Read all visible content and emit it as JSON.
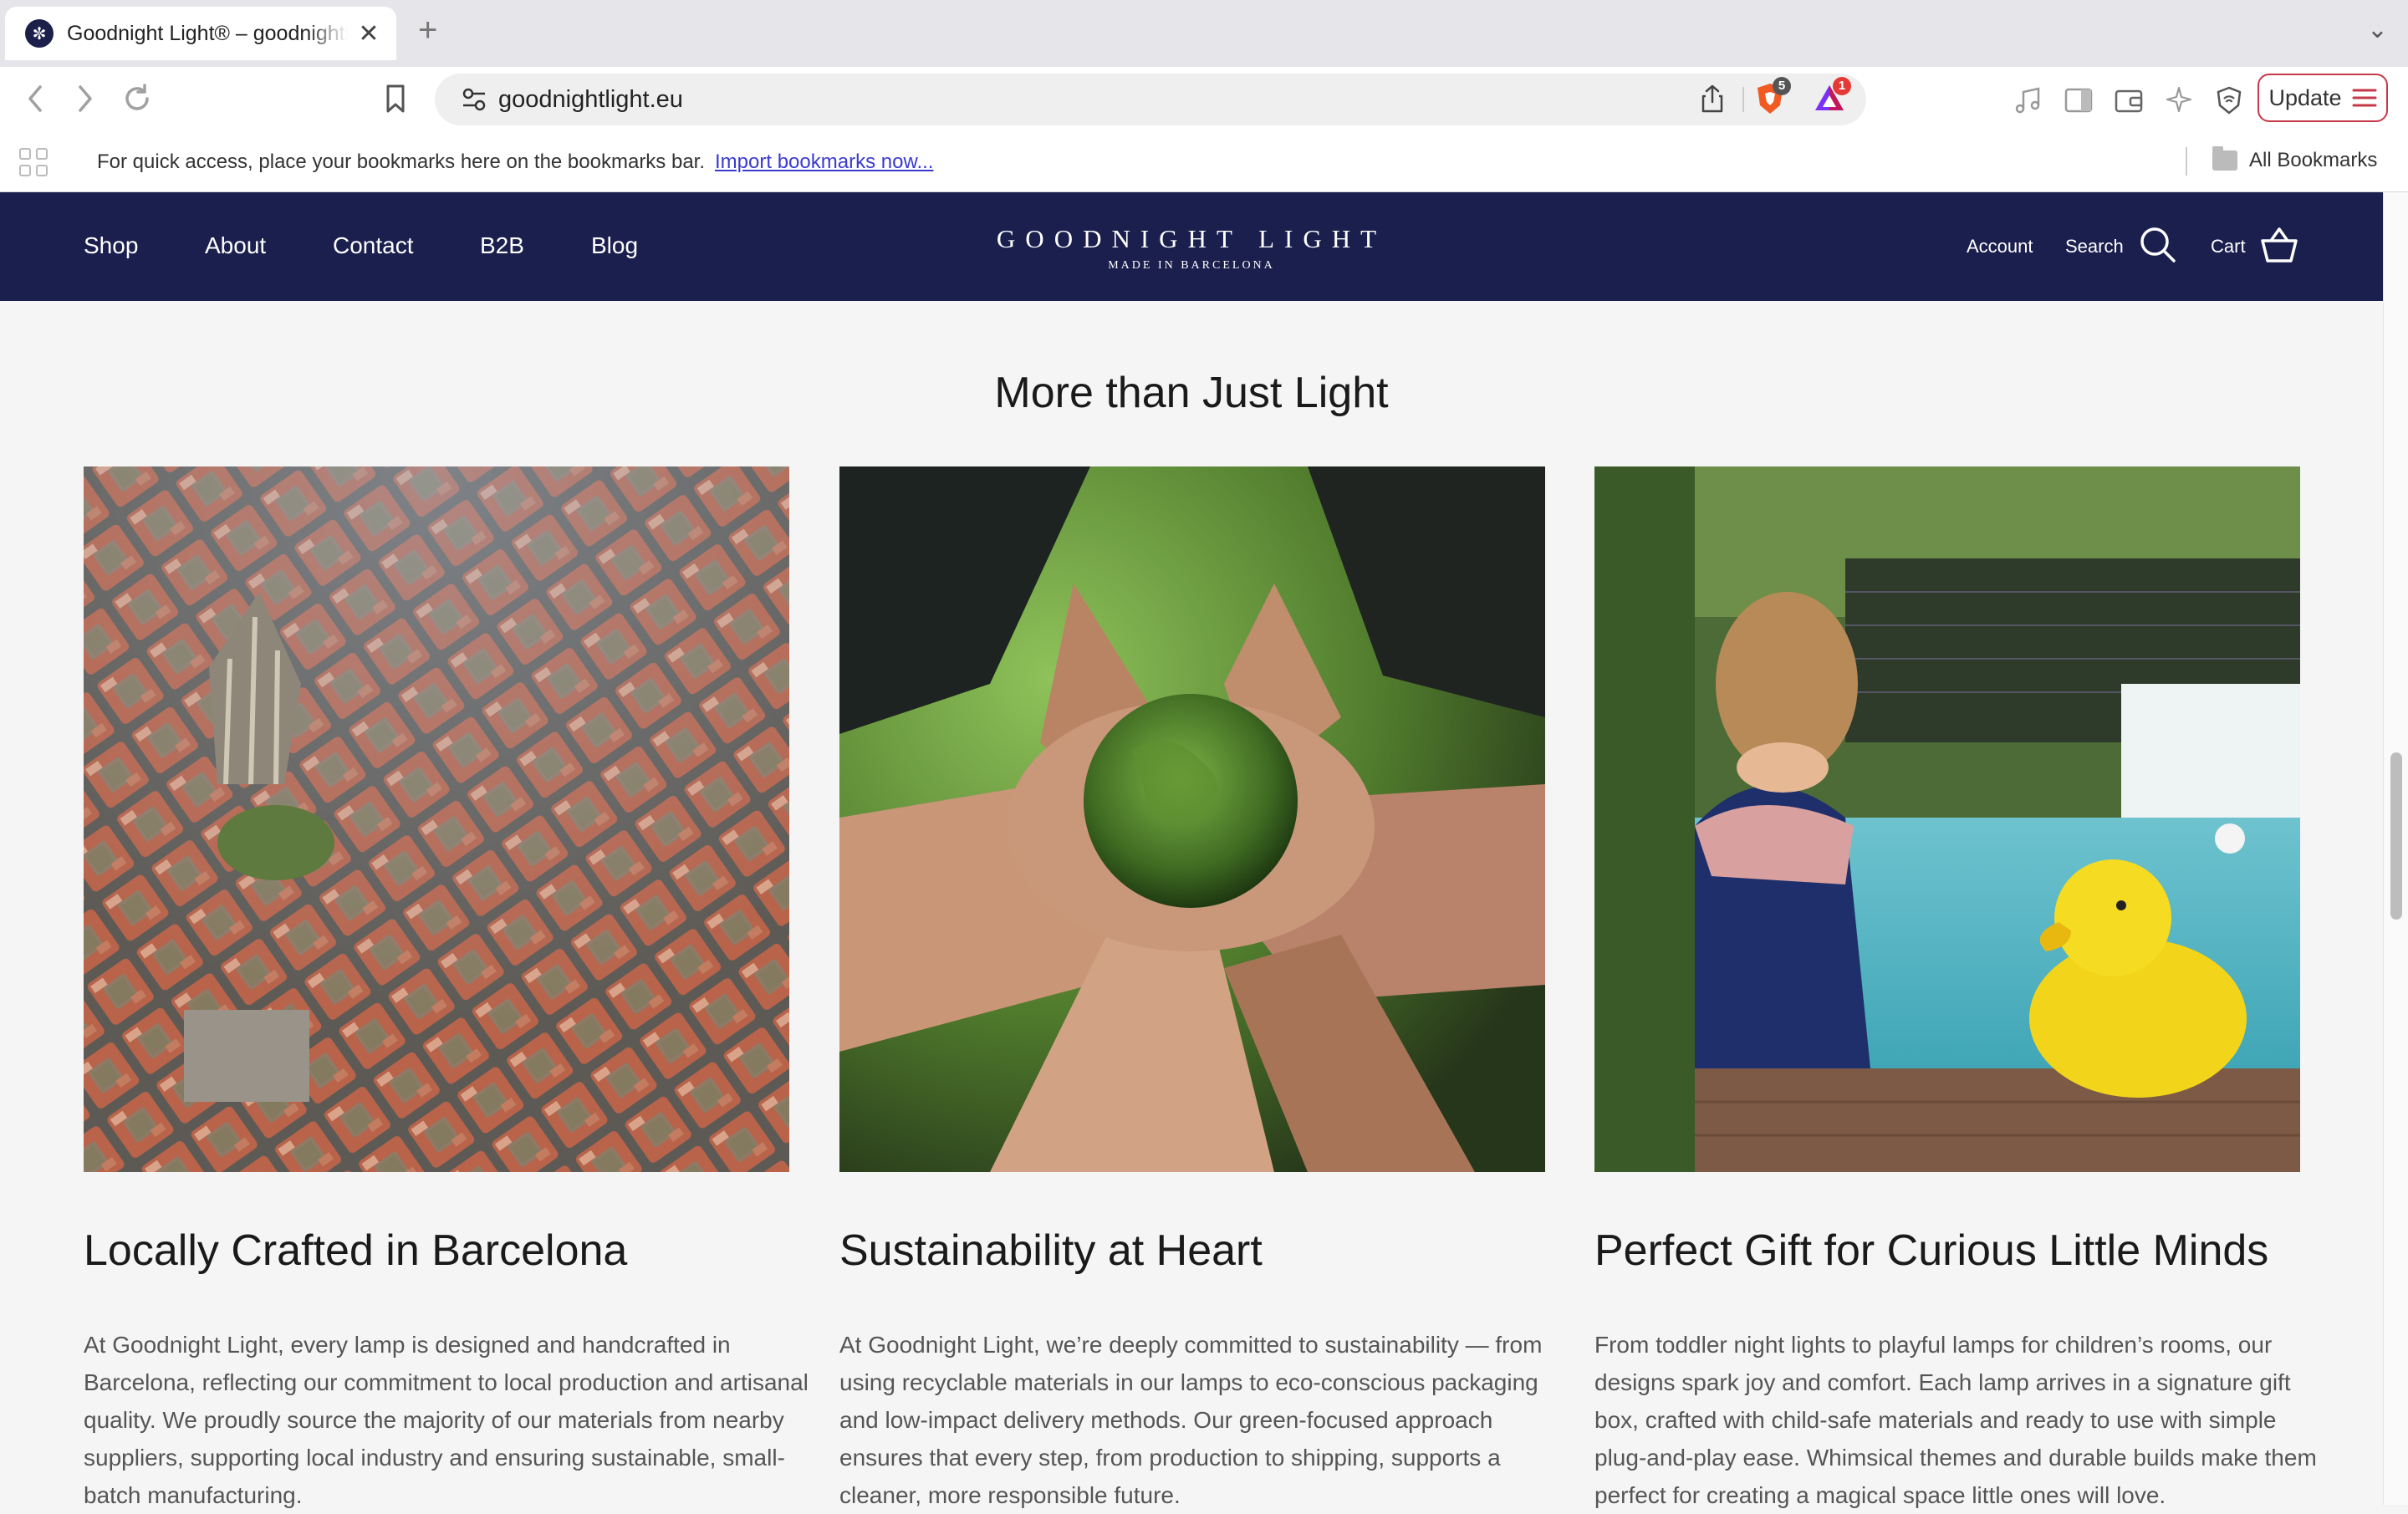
{
  "browser": {
    "tab_title": "Goodnight Light® – goodnightlight.eu",
    "tab_favicon": "✼",
    "new_tab_label": "+",
    "url": "goodnightlight.eu",
    "shield_badge": "5",
    "rewards_badge": "1",
    "update_label": "Update"
  },
  "bookmarks_bar": {
    "message": "For quick access, place your bookmarks here on the bookmarks bar.",
    "import_link": "Import bookmarks now...",
    "all_bookmarks": "All Bookmarks"
  },
  "site": {
    "nav": [
      "Shop",
      "About",
      "Contact",
      "B2B",
      "Blog"
    ],
    "logo_main": "GOODNIGHT LIGHT",
    "logo_sub": "MADE IN BARCELONA",
    "account": "Account",
    "search": "Search",
    "cart": "Cart",
    "brand_color": "#1b1f4e"
  },
  "section": {
    "title": "More than Just Light",
    "cards": [
      {
        "title": "Locally Crafted in Barcelona",
        "text": "At Goodnight Light, every lamp is designed and handcrafted in Barcelona, reflecting our commitment to local production and artisanal quality. We proudly source the majority of our materials from nearby suppliers, supporting local industry and ensuring sustainable, small-batch manufacturing."
      },
      {
        "title": "Sustainability at Heart",
        "text": "At Goodnight Light, we’re deeply committed to sustainability — from using recyclable materials in our lamps to eco-conscious packaging and low-impact delivery methods. Our green-focused approach ensures that every step, from production to shipping, supports a cleaner, more responsible future."
      },
      {
        "title": "Perfect Gift for Curious Little Minds",
        "text": "From toddler night lights to playful lamps for children’s rooms, our designs spark joy and comfort. Each lamp arrives in a signature gift box, crafted with child-safe materials and ready to use with simple plug-and-play ease. Whimsical themes and durable builds make them perfect for creating a magical space little ones will love."
      }
    ]
  }
}
